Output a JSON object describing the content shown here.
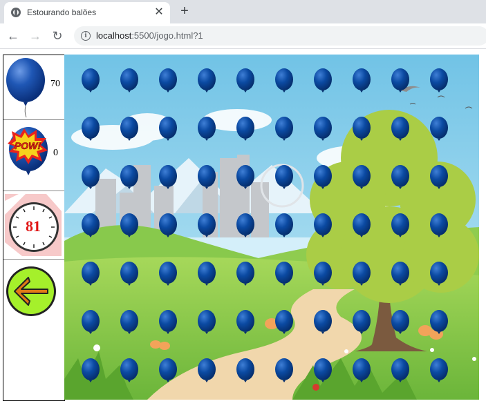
{
  "browser": {
    "tab_title": "Estourando balões",
    "url_host": "localhost",
    "url_rest": ":5500/jogo.html?1",
    "new_tab_symbol": "+",
    "close_symbol": "✕",
    "back_symbol": "←",
    "forward_symbol": "→",
    "reload_symbol": "↻"
  },
  "panel": {
    "balloons_remaining": "70",
    "balloons_popped": "0",
    "timer": "81",
    "icons": [
      "balloon-icon",
      "pow-balloon-icon",
      "clock-icon",
      "back-arrow-icon"
    ]
  },
  "game": {
    "rows": 7,
    "columns": 10,
    "balloon_color": "#0b4aa2",
    "sky_color": "#7dc7e8",
    "grass_color": "#7fc241",
    "tree_color": "#a8cf45"
  }
}
